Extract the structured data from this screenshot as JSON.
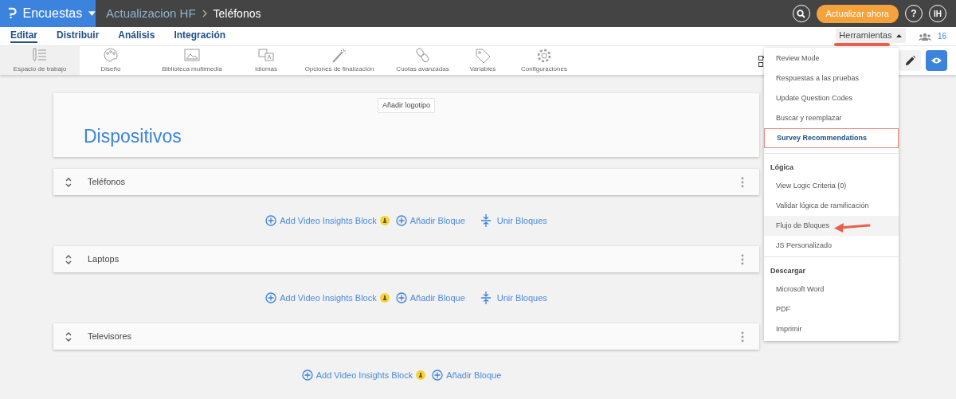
{
  "brand": {
    "label": "Encuestas"
  },
  "breadcrumb": {
    "parent": "Actualizacion HF",
    "current": "Teléfonos"
  },
  "upgrade_button": "Actualizar ahora",
  "help_button": "?",
  "avatar": "IH",
  "nav_tabs": [
    {
      "label": "Editar",
      "selected": true
    },
    {
      "label": "Distribuir",
      "selected": false
    },
    {
      "label": "Análisis",
      "selected": false
    },
    {
      "label": "Integración",
      "selected": false
    }
  ],
  "tools_button": {
    "label": "Herramientas",
    "expanded": true
  },
  "collaborators": "16",
  "toolbar": [
    {
      "kind": "workspace",
      "label": "Espacio de trabajo",
      "selected": true
    },
    {
      "kind": "palette",
      "label": "Diseño",
      "selected": false
    },
    {
      "kind": "image",
      "label": "Biblioteca multimedia",
      "selected": false
    },
    {
      "kind": "language",
      "label": "Idiomas",
      "selected": false
    },
    {
      "kind": "wand",
      "label": "Opciones de finalización",
      "selected": false
    },
    {
      "kind": "link",
      "label": "Cuotas avanzadas",
      "selected": false
    },
    {
      "kind": "tag",
      "label": "Variables",
      "selected": false
    },
    {
      "kind": "gear",
      "label": "Configuraciones",
      "selected": false
    }
  ],
  "survey": {
    "logo_button": "Añadir logotipo",
    "title": "Dispositivos"
  },
  "blocks": [
    {
      "name": "Teléfonos",
      "actions": [
        {
          "kind": "video",
          "label": "Add Video Insights Block"
        },
        {
          "kind": "add",
          "label": "Añadir Bloque"
        },
        {
          "kind": "merge",
          "label": "Unir Bloques"
        }
      ]
    },
    {
      "name": "Laptops",
      "actions": [
        {
          "kind": "video",
          "label": "Add Video Insights Block"
        },
        {
          "kind": "add",
          "label": "Añadir Bloque"
        },
        {
          "kind": "merge",
          "label": "Unir Bloques"
        }
      ]
    },
    {
      "name": "Televisores",
      "actions": [
        {
          "kind": "video",
          "label": "Add Video Insights Block"
        },
        {
          "kind": "add",
          "label": "Añadir Bloque"
        }
      ]
    }
  ],
  "menu": [
    {
      "items": [
        {
          "label": "Review Mode",
          "highlighted": false,
          "hovered": false
        },
        {
          "label": "Respuestas a las pruebas",
          "highlighted": false,
          "hovered": false
        },
        {
          "label": "Update Question Codes",
          "highlighted": false,
          "hovered": false
        },
        {
          "label": "Buscar y reemplazar",
          "highlighted": false,
          "hovered": false
        },
        {
          "label": "Survey Recommendations",
          "highlighted": true,
          "hovered": false
        }
      ]
    },
    {
      "header": "Lógica",
      "items": [
        {
          "label": "View Logic Criteria (0)",
          "highlighted": false,
          "hovered": false
        },
        {
          "label": "Validar lógica de ramificación",
          "highlighted": false,
          "hovered": false
        },
        {
          "label": "Flujo de Bloques",
          "highlighted": false,
          "hovered": true
        },
        {
          "label": "JS Personalizado",
          "highlighted": false,
          "hovered": false
        }
      ]
    },
    {
      "header": "Descargar",
      "items": [
        {
          "label": "Microsoft Word",
          "highlighted": false,
          "hovered": false
        },
        {
          "label": "PDF",
          "highlighted": false,
          "hovered": false
        },
        {
          "label": "Imprimir",
          "highlighted": false,
          "hovered": false
        }
      ]
    }
  ]
}
